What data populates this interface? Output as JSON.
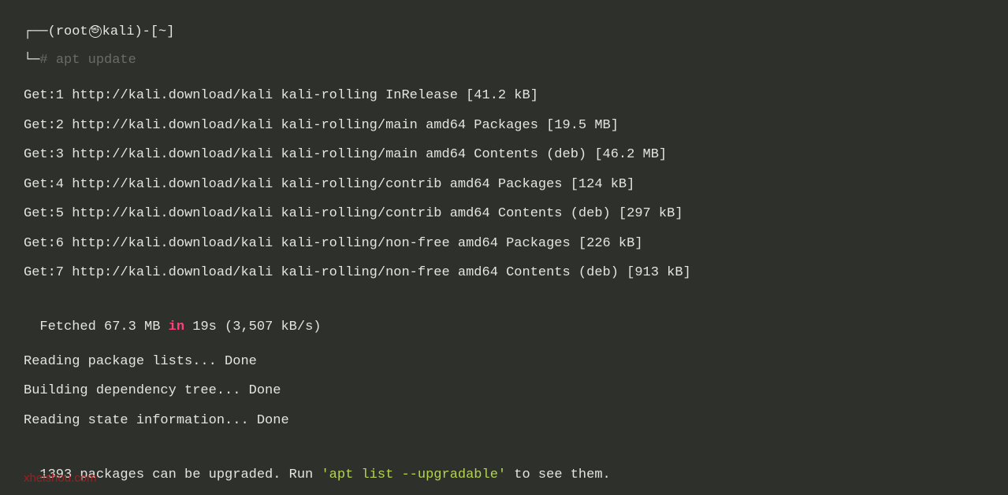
{
  "prompt": {
    "user": "root",
    "host": "kali",
    "path": "~",
    "cmd_prefix": "#",
    "command": "apt update"
  },
  "lines": [
    "Get:1 http://kali.download/kali kali-rolling InRelease [41.2 kB]",
    "Get:2 http://kali.download/kali kali-rolling/main amd64 Packages [19.5 MB]",
    "Get:3 http://kali.download/kali kali-rolling/main amd64 Contents (deb) [46.2 MB]",
    "Get:4 http://kali.download/kali kali-rolling/contrib amd64 Packages [124 kB]",
    "Get:5 http://kali.download/kali kali-rolling/contrib amd64 Contents (deb) [297 kB]",
    "Get:6 http://kali.download/kali kali-rolling/non-free amd64 Packages [226 kB]",
    "Get:7 http://kali.download/kali kali-rolling/non-free amd64 Contents (deb) [913 kB]"
  ],
  "fetched": {
    "prefix": "Fetched 67.3 MB ",
    "keyword": "in",
    "suffix": " 19s (3,507 kB/s)"
  },
  "reading1": "Reading package lists... Done",
  "building": "Building dependency tree... Done",
  "reading2": "Reading state information... Done",
  "upgrade": {
    "prefix": "1393 packages can be upgraded. Run ",
    "quoted": "'apt list --upgradable'",
    "suffix": " to see them."
  },
  "watermark": "xheishou.com"
}
